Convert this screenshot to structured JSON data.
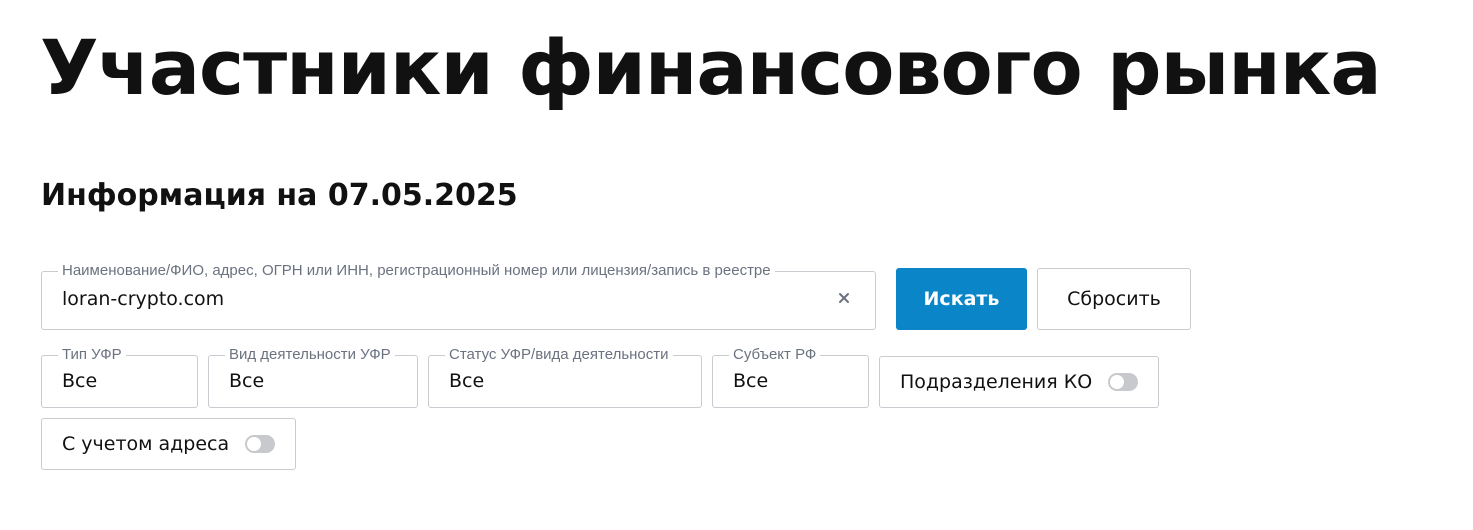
{
  "page": {
    "title": "Участники финансового рынка",
    "info_date": "Информация на 07.05.2025"
  },
  "search": {
    "label": "Наименование/ФИО, адрес, ОГРН или ИНН, регистрационный номер или лицензия/запись в реестре",
    "value": "loran-crypto.com",
    "clear_icon": "close-icon",
    "search_button": "Искать",
    "reset_button": "Сбросить"
  },
  "filters": {
    "type": {
      "label": "Тип УФР",
      "value": "Все"
    },
    "activity": {
      "label": "Вид деятельности УФР",
      "value": "Все"
    },
    "status": {
      "label": "Статус УФР/вида деятельности",
      "value": "Все"
    },
    "region": {
      "label": "Субъект РФ",
      "value": "Все"
    }
  },
  "toggles": {
    "ko_divisions": {
      "label": "Подразделения КО",
      "checked": false
    },
    "with_address": {
      "label": "С учетом адреса",
      "checked": false
    }
  },
  "colors": {
    "primary": "#0a85c7",
    "border": "#c8cbd0",
    "label": "#6b7280",
    "switch_off": "#c7c9cc"
  }
}
